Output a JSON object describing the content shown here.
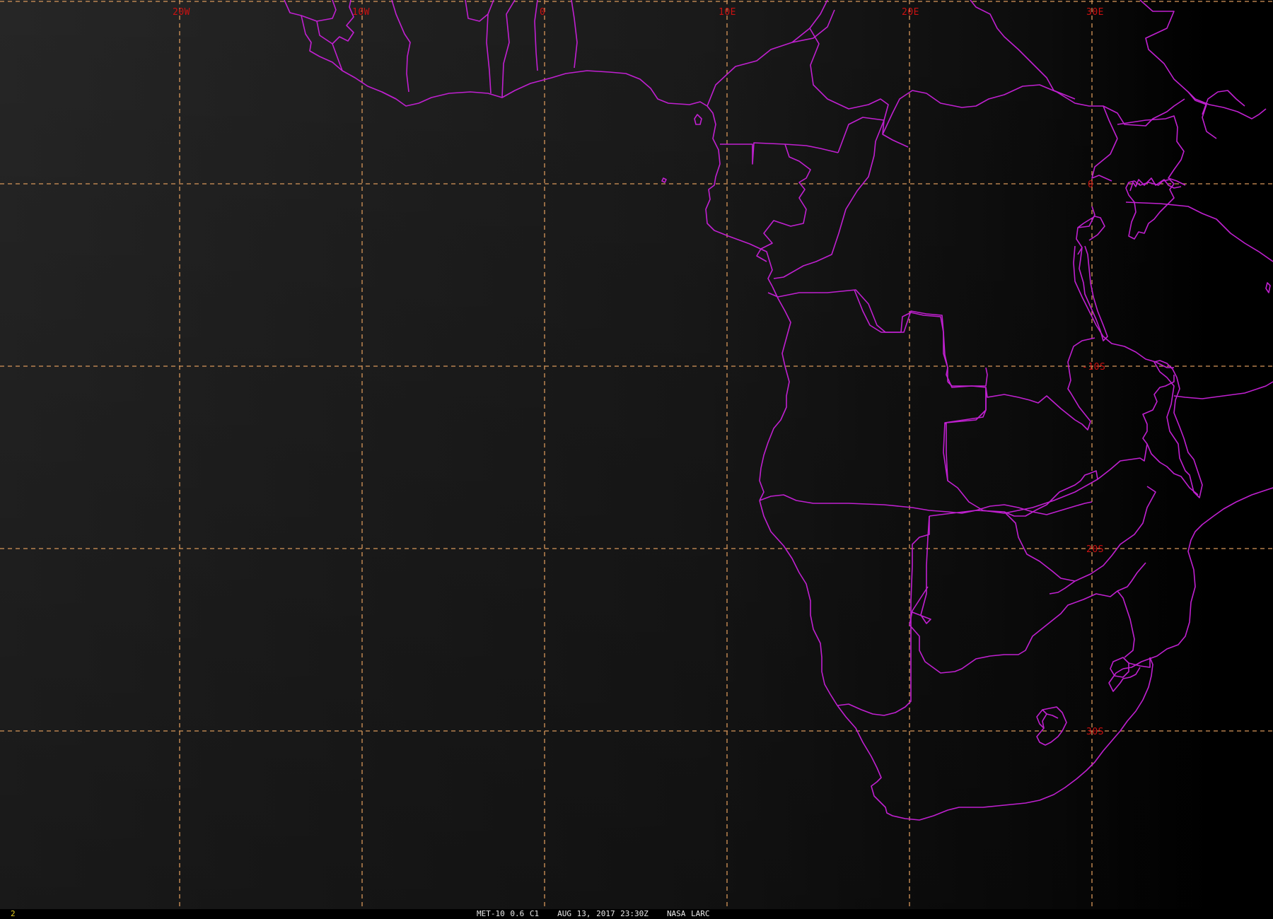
{
  "map": {
    "title": "MET-10 0.6 C1",
    "date_time": "AUG 13, 2017 23:30Z",
    "source": "NASA LARC",
    "frame_number": "2",
    "colors": {
      "background_light": "#242424",
      "background_dark": "#000000",
      "graticule": "#d8975a",
      "boundaries": "#c020d0",
      "labels": "#cc1111",
      "frame_number": "#e8d020"
    },
    "longitude_labels": [
      {
        "lon": -20,
        "text": "20W"
      },
      {
        "lon": -10,
        "text": "10W"
      },
      {
        "lon": 0,
        "text": "0"
      },
      {
        "lon": 10,
        "text": "10E"
      },
      {
        "lon": 20,
        "text": "20E"
      },
      {
        "lon": 30,
        "text": "30E"
      }
    ],
    "latitude_labels": [
      {
        "lat": 0,
        "text": "0"
      },
      {
        "lat": -10,
        "text": "-10S"
      },
      {
        "lat": -20,
        "text": "20S"
      },
      {
        "lat": -30,
        "text": "30S"
      }
    ],
    "extra_latitude_lines": [
      10
    ],
    "extra_longitude_lines": [
      40
    ]
  }
}
